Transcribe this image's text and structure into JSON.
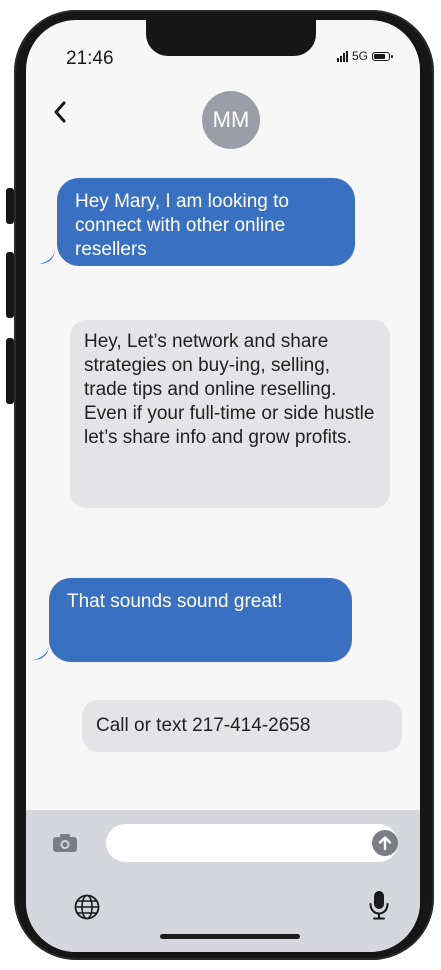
{
  "status_bar": {
    "time": "21:46",
    "network": "5G",
    "battery_level": 0.8
  },
  "header": {
    "back_icon": "chevron-left-icon",
    "contact_initials": "MM"
  },
  "messages": [
    {
      "direction": "sent",
      "text": "Hey Mary, I am looking to connect with other online resellers"
    },
    {
      "direction": "received",
      "text": "Hey, Let’s network and share strategies on buy-ing, selling, trade tips and online reselling. Even if your full-time or side hustle let’s share info and grow profits."
    },
    {
      "direction": "sent",
      "text": "That sounds sound great!"
    },
    {
      "direction": "received",
      "text": "Call or text 217-414-2658"
    }
  ],
  "composer": {
    "input_value": "",
    "camera_icon": "camera-icon",
    "send_icon": "arrow-up-icon",
    "globe_icon": "globe-icon",
    "mic_icon": "microphone-icon"
  },
  "colors": {
    "sent_bubble": "#3a70c2",
    "received_bubble": "#e4e4e6",
    "frame": "#161616",
    "screen_bg": "#f7f7f7",
    "keyboard_bar": "#d5d7dc"
  }
}
